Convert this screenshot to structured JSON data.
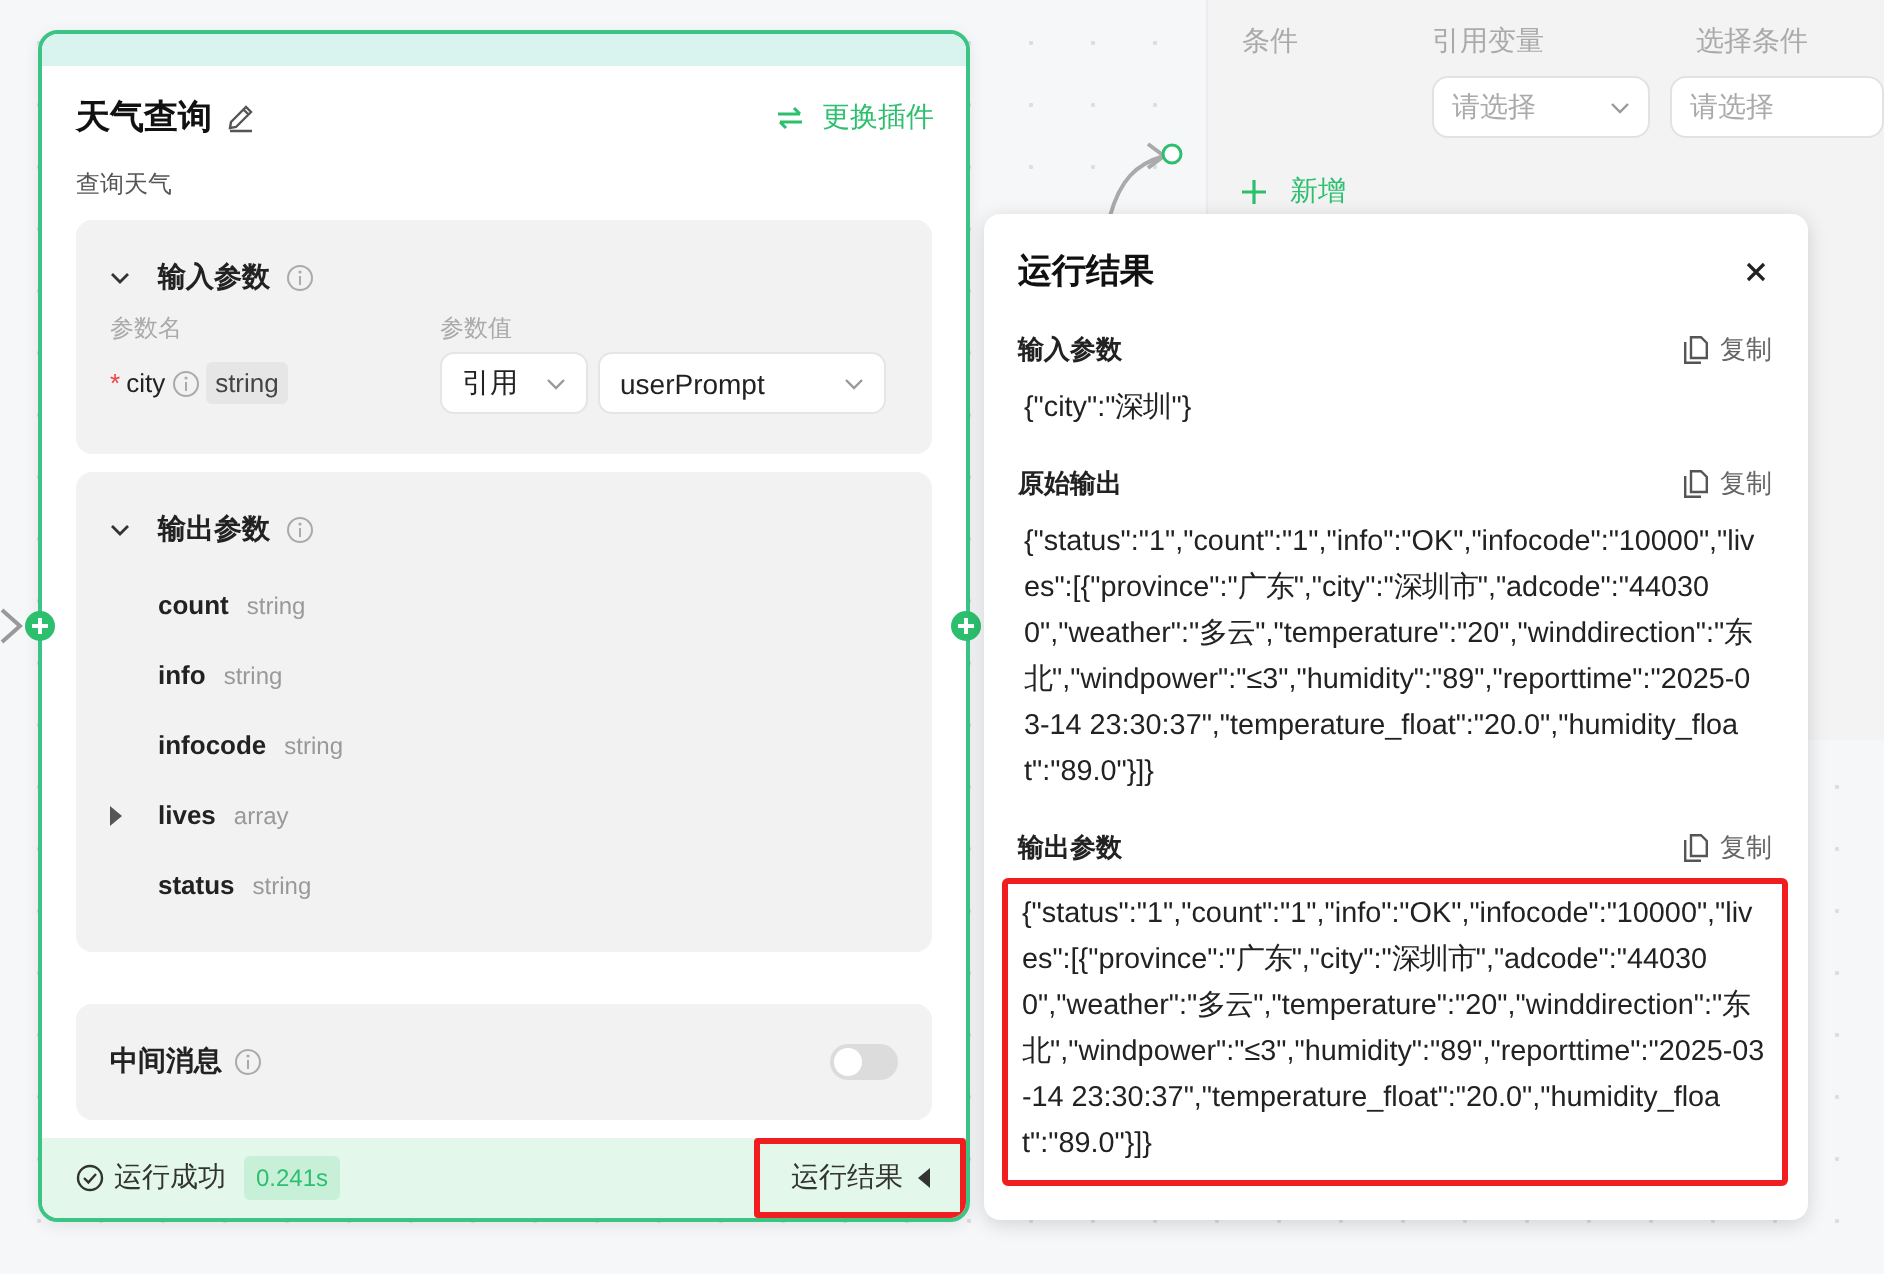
{
  "plugin_node": {
    "title": "天气查询",
    "switch_action": "更换插件",
    "description": "查询天气",
    "input_section": {
      "title": "输入参数",
      "expanded": true,
      "name_header": "参数名",
      "value_header": "参数值",
      "params": [
        {
          "required_mark": "*",
          "name": "city",
          "type": "string",
          "source": "引用",
          "value": "userPrompt"
        }
      ]
    },
    "output_section": {
      "title": "输出参数",
      "expanded": true,
      "fields": [
        {
          "name": "count",
          "type": "string"
        },
        {
          "name": "info",
          "type": "string"
        },
        {
          "name": "infocode",
          "type": "string"
        },
        {
          "name": "lives",
          "type": "array",
          "expanded": false
        },
        {
          "name": "status",
          "type": "string"
        }
      ]
    },
    "intermediate": {
      "label": "中间消息",
      "on": false
    },
    "footer": {
      "status": "运行成功",
      "duration": "0.241s",
      "result_button": "运行结果",
      "highlighted": true
    }
  },
  "condition_node": {
    "headers": [
      "条件",
      "引用变量",
      "选择条件"
    ],
    "selects": [
      {
        "placeholder": "请选择"
      },
      {
        "placeholder": "请选择"
      }
    ],
    "add_label": "新增"
  },
  "result_panel": {
    "title": "运行结果",
    "sections": [
      {
        "title": "输入参数",
        "copy": "复制",
        "content": "{\"city\":\"深圳\"}",
        "highlighted": false
      },
      {
        "title": "原始输出",
        "copy": "复制",
        "content": "{\"status\":\"1\",\"count\":\"1\",\"info\":\"OK\",\"infocode\":\"10000\",\"lives\":[{\"province\":\"广东\",\"city\":\"深圳市\",\"adcode\":\"440300\",\"weather\":\"多云\",\"temperature\":\"20\",\"winddirection\":\"东北\",\"windpower\":\"≤3\",\"humidity\":\"89\",\"reporttime\":\"2025-03-14 23:30:37\",\"temperature_float\":\"20.0\",\"humidity_float\":\"89.0\"}]}",
        "highlighted": false
      },
      {
        "title": "输出参数",
        "copy": "复制",
        "content": "{\"status\":\"1\",\"count\":\"1\",\"info\":\"OK\",\"infocode\":\"10000\",\"lives\":[{\"province\":\"广东\",\"city\":\"深圳市\",\"adcode\":\"440300\",\"weather\":\"多云\",\"temperature\":\"20\",\"winddirection\":\"东北\",\"windpower\":\"≤3\",\"humidity\":\"89\",\"reporttime\":\"2025-03-14 23:30:37\",\"temperature_float\":\"20.0\",\"humidity_float\":\"89.0\"}]}",
        "highlighted": true
      }
    ]
  }
}
